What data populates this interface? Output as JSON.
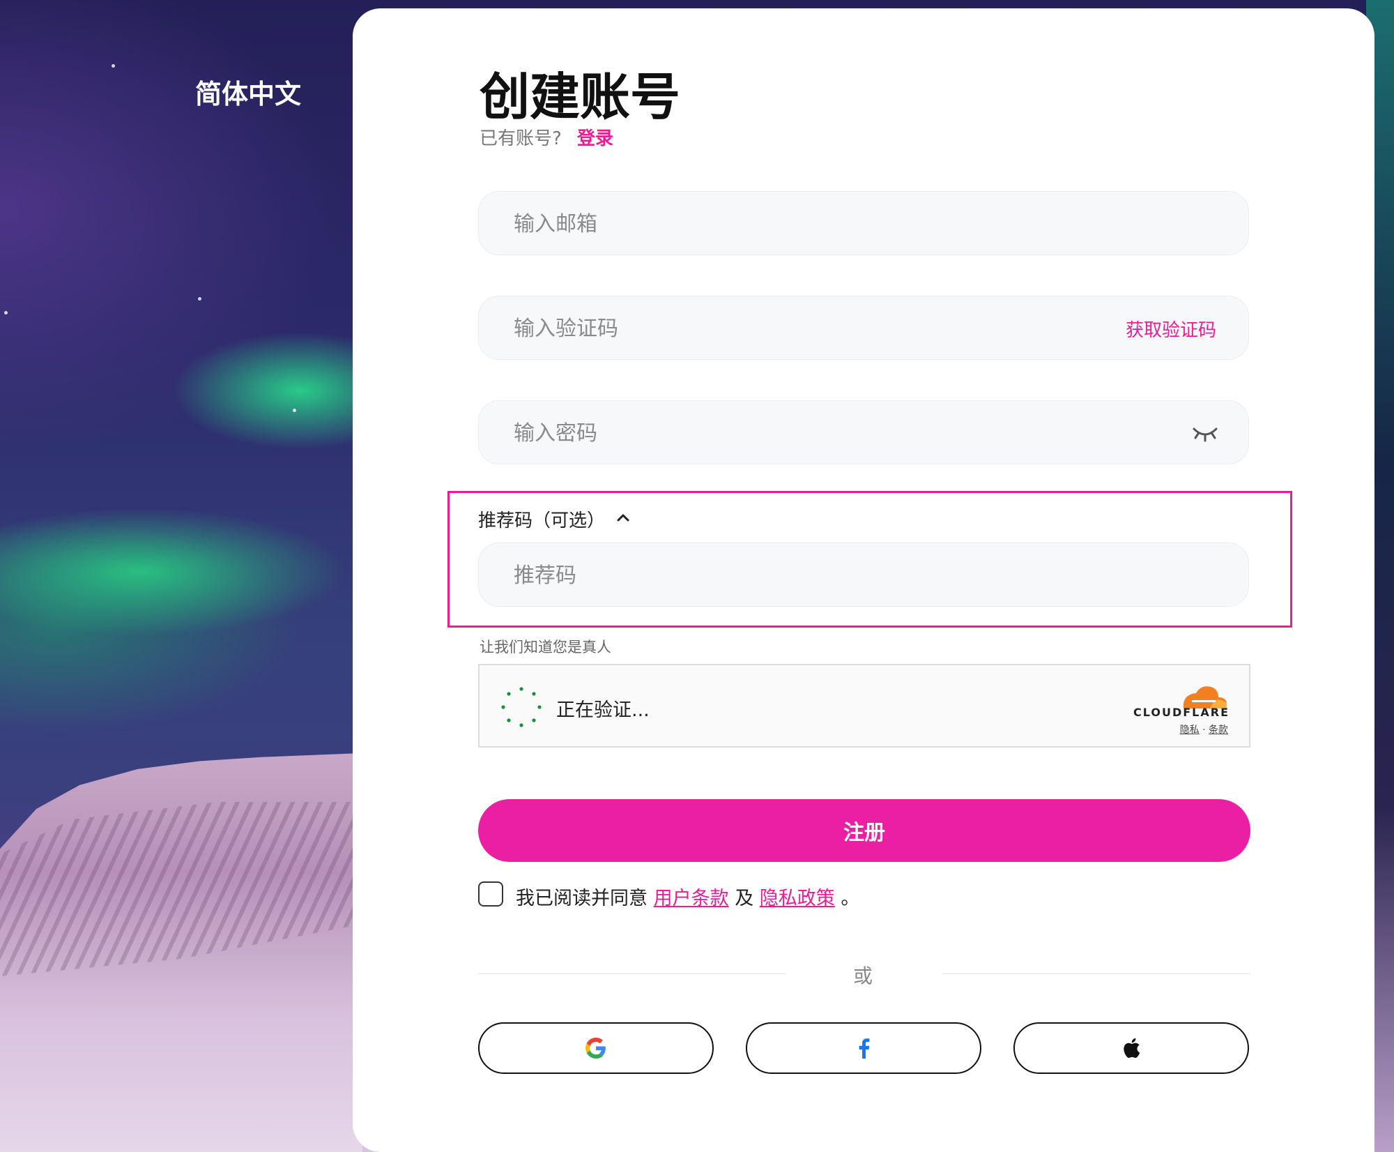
{
  "language": "简体中文",
  "header": {
    "title": "创建账号",
    "have_account": "已有账号?",
    "login_link": "登录"
  },
  "form": {
    "email_placeholder": "输入邮箱",
    "code_placeholder": "输入验证码",
    "get_code": "获取验证码",
    "password_placeholder": "输入密码",
    "referral_label": "推荐码（可选）",
    "referral_placeholder": "推荐码"
  },
  "captcha": {
    "prompt": "让我们知道您是真人",
    "status": "正在验证...",
    "brand": "CLOUDFLARE",
    "privacy": "隐私",
    "separator": "·",
    "terms": "条款"
  },
  "register_label": "注册",
  "agreement": {
    "prefix": "我已阅读并同意",
    "terms": "用户条款",
    "and": "及",
    "privacy": "隐私政策",
    "suffix": "。"
  },
  "or_text": "或",
  "social": [
    "google-icon",
    "facebook-icon",
    "apple-icon"
  ],
  "colors": {
    "accent": "#e91e96",
    "button": "#eb1fa3"
  }
}
